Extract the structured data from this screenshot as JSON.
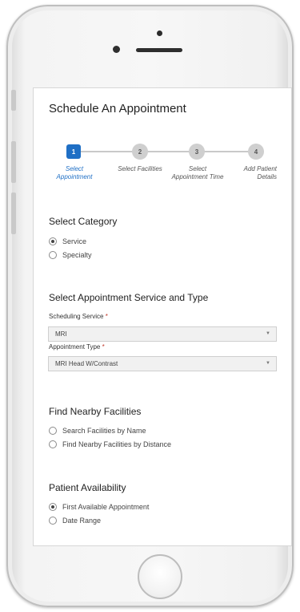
{
  "header": {
    "title": "Schedule An Appointment"
  },
  "stepper": [
    {
      "number": "1",
      "label_line1": "Select",
      "label_line2": "Appointment",
      "active": true
    },
    {
      "number": "2",
      "label_line1": "Select Facilities",
      "label_line2": "",
      "active": false
    },
    {
      "number": "3",
      "label_line1": "Select",
      "label_line2": "Appointment Time",
      "active": false
    },
    {
      "number": "4",
      "label_line1": "Add Patient",
      "label_line2": "Details",
      "active": false
    }
  ],
  "category": {
    "heading": "Select Category",
    "options": [
      {
        "label": "Service",
        "selected": true
      },
      {
        "label": "Specialty",
        "selected": false
      }
    ]
  },
  "service_type": {
    "heading": "Select Appointment Service and Type",
    "scheduling_service": {
      "label": "Scheduling Service",
      "required_mark": "*",
      "value": "MRI"
    },
    "appointment_type": {
      "label": "Appointment Type",
      "required_mark": "*",
      "value": "MRI Head W/Contrast"
    }
  },
  "facilities": {
    "heading": "Find Nearby Facilities",
    "options": [
      {
        "label": "Search Facilities by Name",
        "selected": false
      },
      {
        "label": "Find Nearby Facilities by Distance",
        "selected": false
      }
    ]
  },
  "availability": {
    "heading": "Patient Availability",
    "options": [
      {
        "label": "First Available Appointment",
        "selected": true
      },
      {
        "label": "Date Range",
        "selected": false
      }
    ]
  },
  "colors": {
    "accent": "#1f6fc5",
    "required": "#c0392b",
    "inactive_step": "#cfcfcf"
  }
}
